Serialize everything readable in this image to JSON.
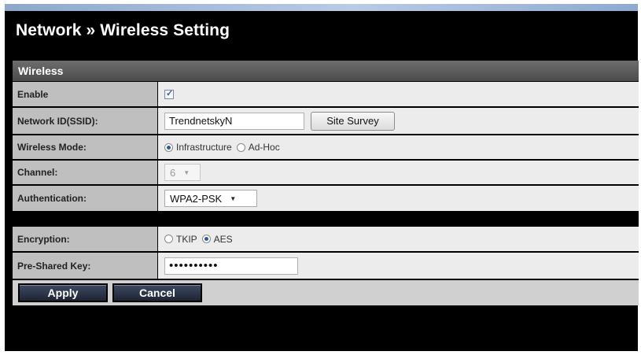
{
  "page": {
    "title": "Network » Wireless Setting"
  },
  "section": {
    "title": "Wireless"
  },
  "rows": {
    "enable": {
      "label": "Enable",
      "checked": true
    },
    "ssid": {
      "label": "Network ID(SSID):",
      "value": "TrendnetskyN",
      "survey_label": "Site Survey"
    },
    "mode": {
      "label": "Wireless Mode:",
      "options": [
        "Infrastructure",
        "Ad-Hoc"
      ],
      "selected": "Infrastructure"
    },
    "channel": {
      "label": "Channel:",
      "value": "6",
      "disabled": true
    },
    "auth": {
      "label": "Authentication:",
      "value": "WPA2-PSK"
    },
    "encryption": {
      "label": "Encryption:",
      "options": [
        "TKIP",
        "AES"
      ],
      "selected": "AES"
    },
    "psk": {
      "label": "Pre-Shared Key:",
      "value": "••••••••••"
    }
  },
  "actions": {
    "apply": "Apply",
    "cancel": "Cancel"
  },
  "colors": {
    "accent": "#2c5aa0",
    "header_band": "#5a5a5a",
    "label_bg": "#bfbfbf",
    "value_bg": "#ececec"
  }
}
